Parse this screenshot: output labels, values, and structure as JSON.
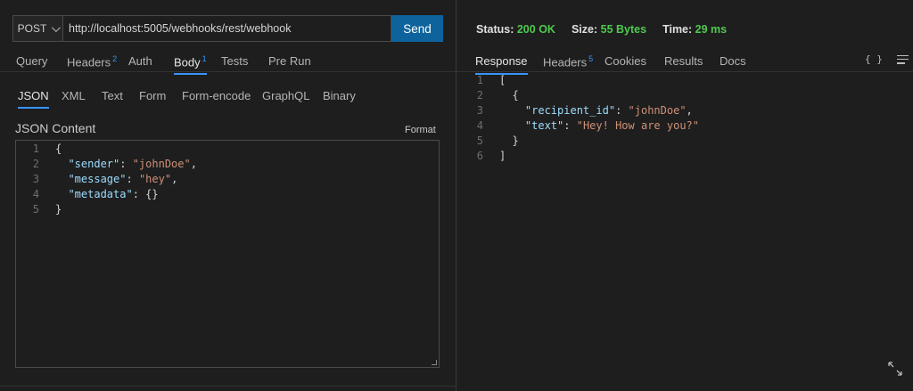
{
  "request": {
    "method": "POST",
    "url": "http://localhost:5005/webhooks/rest/webhook",
    "send_label": "Send"
  },
  "request_tabs": [
    {
      "label": "Query",
      "badge": ""
    },
    {
      "label": "Headers",
      "badge": "2"
    },
    {
      "label": "Auth",
      "badge": ""
    },
    {
      "label": "Body",
      "badge": "1"
    },
    {
      "label": "Tests",
      "badge": ""
    },
    {
      "label": "Pre Run",
      "badge": ""
    }
  ],
  "body_tabs": [
    "JSON",
    "XML",
    "Text",
    "Form",
    "Form-encode",
    "GraphQL",
    "Binary"
  ],
  "content_label": "JSON Content",
  "format_label": "Format",
  "request_body_lines": [
    "1",
    "2",
    "3",
    "4",
    "5"
  ],
  "request_body": [
    [
      {
        "t": "p",
        "v": "{"
      }
    ],
    [
      {
        "t": "p",
        "v": "  "
      },
      {
        "t": "k",
        "v": "\"sender\""
      },
      {
        "t": "p",
        "v": ": "
      },
      {
        "t": "s",
        "v": "\"johnDoe\""
      },
      {
        "t": "p",
        "v": ","
      }
    ],
    [
      {
        "t": "p",
        "v": "  "
      },
      {
        "t": "k",
        "v": "\"message\""
      },
      {
        "t": "p",
        "v": ": "
      },
      {
        "t": "s",
        "v": "\"hey\""
      },
      {
        "t": "p",
        "v": ","
      }
    ],
    [
      {
        "t": "p",
        "v": "  "
      },
      {
        "t": "k",
        "v": "\"metadata\""
      },
      {
        "t": "p",
        "v": ": {}"
      }
    ],
    [
      {
        "t": "p",
        "v": "}"
      }
    ]
  ],
  "status": {
    "status_label": "Status:",
    "status_value": "200 OK",
    "size_label": "Size:",
    "size_value": "55 Bytes",
    "time_label": "Time:",
    "time_value": "29 ms"
  },
  "response_tabs": [
    {
      "label": "Response",
      "badge": ""
    },
    {
      "label": "Headers",
      "badge": "5"
    },
    {
      "label": "Cookies",
      "badge": ""
    },
    {
      "label": "Results",
      "badge": ""
    },
    {
      "label": "Docs",
      "badge": ""
    }
  ],
  "braces_label": "{ }",
  "response_body_lines": [
    "1",
    "2",
    "3",
    "4",
    "5",
    "6"
  ],
  "response_body": [
    [
      {
        "t": "p",
        "v": "["
      }
    ],
    [
      {
        "t": "p",
        "v": "  {"
      }
    ],
    [
      {
        "t": "p",
        "v": "    "
      },
      {
        "t": "k",
        "v": "\"recipient_id\""
      },
      {
        "t": "p",
        "v": ": "
      },
      {
        "t": "s",
        "v": "\"johnDoe\""
      },
      {
        "t": "p",
        "v": ","
      }
    ],
    [
      {
        "t": "p",
        "v": "    "
      },
      {
        "t": "k",
        "v": "\"text\""
      },
      {
        "t": "p",
        "v": ": "
      },
      {
        "t": "s",
        "v": "\"Hey! How are you?\""
      }
    ],
    [
      {
        "t": "p",
        "v": "  }"
      }
    ],
    [
      {
        "t": "p",
        "v": "]"
      }
    ]
  ],
  "colors": {
    "accent": "#3794ff",
    "send_button": "#0e639c",
    "status_ok": "#4ec94e",
    "json_key": "#9cdcfe",
    "json_string": "#ce9178"
  },
  "icons": {
    "method_dropdown": "chevron-down-icon",
    "response_format": "braces-icon",
    "response_menu": "lines-icon",
    "expand": "expand-icon"
  }
}
